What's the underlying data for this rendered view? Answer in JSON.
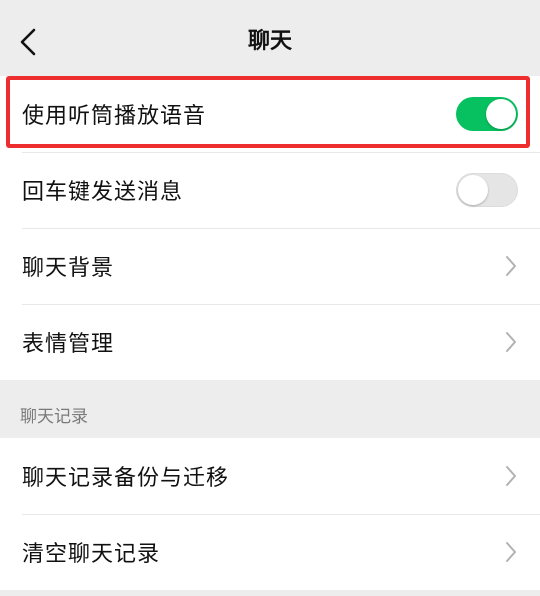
{
  "navbar": {
    "title": "聊天",
    "back_icon": "chevron-left-icon"
  },
  "settings": {
    "group1": [
      {
        "label": "使用听筒播放语音",
        "control": "toggle",
        "on": true
      },
      {
        "label": "回车键发送消息",
        "control": "toggle",
        "on": false
      },
      {
        "label": "聊天背景",
        "control": "chevron"
      },
      {
        "label": "表情管理",
        "control": "chevron"
      }
    ],
    "section_header": "聊天记录",
    "group2": [
      {
        "label": "聊天记录备份与迁移",
        "control": "chevron"
      },
      {
        "label": "清空聊天记录",
        "control": "chevron"
      }
    ]
  },
  "colors": {
    "toggle_on": "#07c160",
    "toggle_off": "#e5e5e5",
    "highlight_border": "#ee2e2e",
    "page_background": "#ededed"
  }
}
